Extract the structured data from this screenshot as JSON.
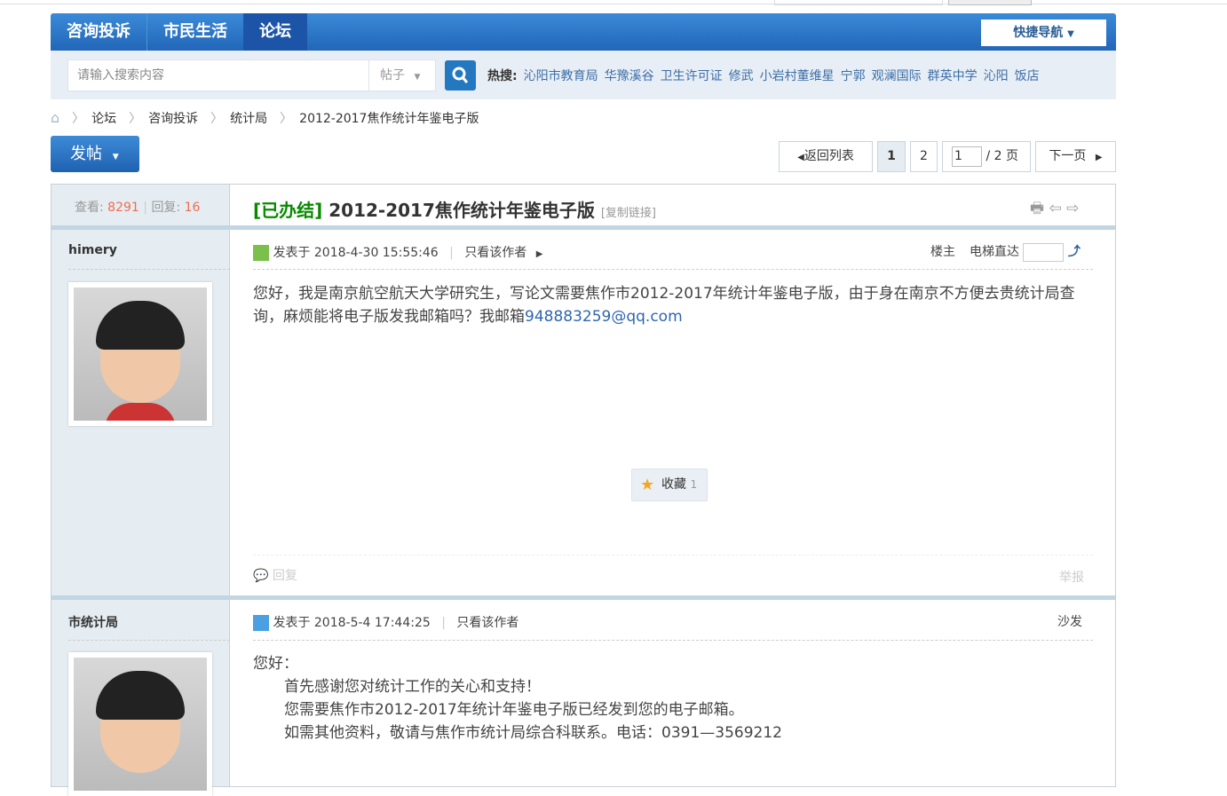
{
  "nav": {
    "tabs": [
      "咨询投诉",
      "市民生活",
      "论坛"
    ],
    "quick_nav": "快捷导航"
  },
  "search": {
    "placeholder": "请输入搜索内容",
    "type": "帖子",
    "hot_label": "热搜:",
    "hot": [
      "沁阳市教育局",
      "华豫溪谷",
      "卫生许可证",
      "修武",
      "小岩村董维星",
      "宁郭",
      "观澜国际",
      "群英中学",
      "沁阳",
      "饭店"
    ]
  },
  "breadcrumb": [
    "论坛",
    "咨询投诉",
    "统计局",
    "2012-2017焦作统计年鉴电子版"
  ],
  "toolbar": {
    "post": "发帖",
    "back": "返回列表",
    "pages": [
      "1",
      "2"
    ],
    "page_input": "1",
    "page_total": "/ 2 页",
    "next": "下一页"
  },
  "thread": {
    "views_label": "查看:",
    "views": "8291",
    "replies_label": "回复:",
    "replies": "16",
    "status": "[已办结]",
    "title": "2012-2017焦作统计年鉴电子版",
    "copy_link": "[复制链接]"
  },
  "posts": [
    {
      "author": "himery",
      "time": "发表于 2018-4-30 15:55:46",
      "only_author": "只看该作者",
      "floor": "楼主",
      "jump": "电梯直达",
      "content": "您好，我是南京航空航天大学研究生，写论文需要焦作市2012-2017年统计年鉴电子版，由于身在南京不方便去贵统计局查询，麻烦能将电子版发我邮箱吗？我邮箱",
      "email": "948883259@qq.com",
      "fav": "收藏",
      "fav_count": "1",
      "reply": "回复",
      "report": "举报"
    },
    {
      "author": "市统计局",
      "time": "发表于 2018-5-4 17:44:25",
      "only_author": "只看该作者",
      "floor": "沙发",
      "lines": [
        "您好：",
        "首先感谢您对统计工作的关心和支持！",
        "您需要焦作市2012-2017年统计年鉴电子版已经发到您的电子邮箱。",
        "如需其他资料，敬请与焦作市统计局综合科联系。电话：0391—3569212"
      ]
    }
  ]
}
